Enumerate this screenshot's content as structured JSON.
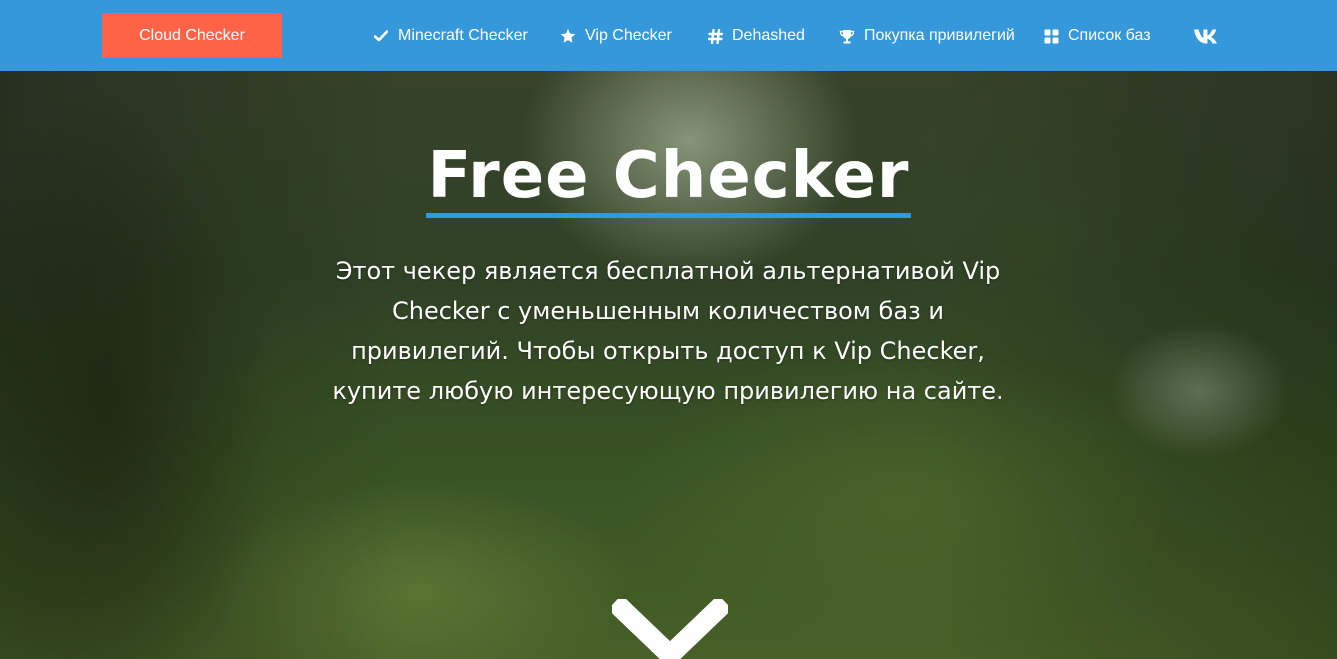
{
  "header": {
    "brand_label": "Cloud Checker",
    "nav": [
      {
        "label": "Minecraft Checker",
        "icon": "check-icon"
      },
      {
        "label": "Vip Checker",
        "icon": "star-icon"
      },
      {
        "label": "Dehashed",
        "icon": "hashtag-icon"
      },
      {
        "label": "Покупка привилегий",
        "icon": "trophy-icon"
      },
      {
        "label": "Список баз",
        "icon": "grid-icon"
      }
    ],
    "social_icon": "vk-icon"
  },
  "hero": {
    "title": "Free Checker",
    "description": "Этот чекер является бесплатной альтернативой Vip Checker с уменьшенным количеством баз и привилегий. Чтобы открыть доступ к Vip Checker, купите любую интересующую привилегию на сайте.",
    "scroll_icon": "chevron-down-icon"
  },
  "colors": {
    "navbar": "#3498db",
    "brand": "#ff6347",
    "underline": "#3498db",
    "text": "#ffffff"
  }
}
